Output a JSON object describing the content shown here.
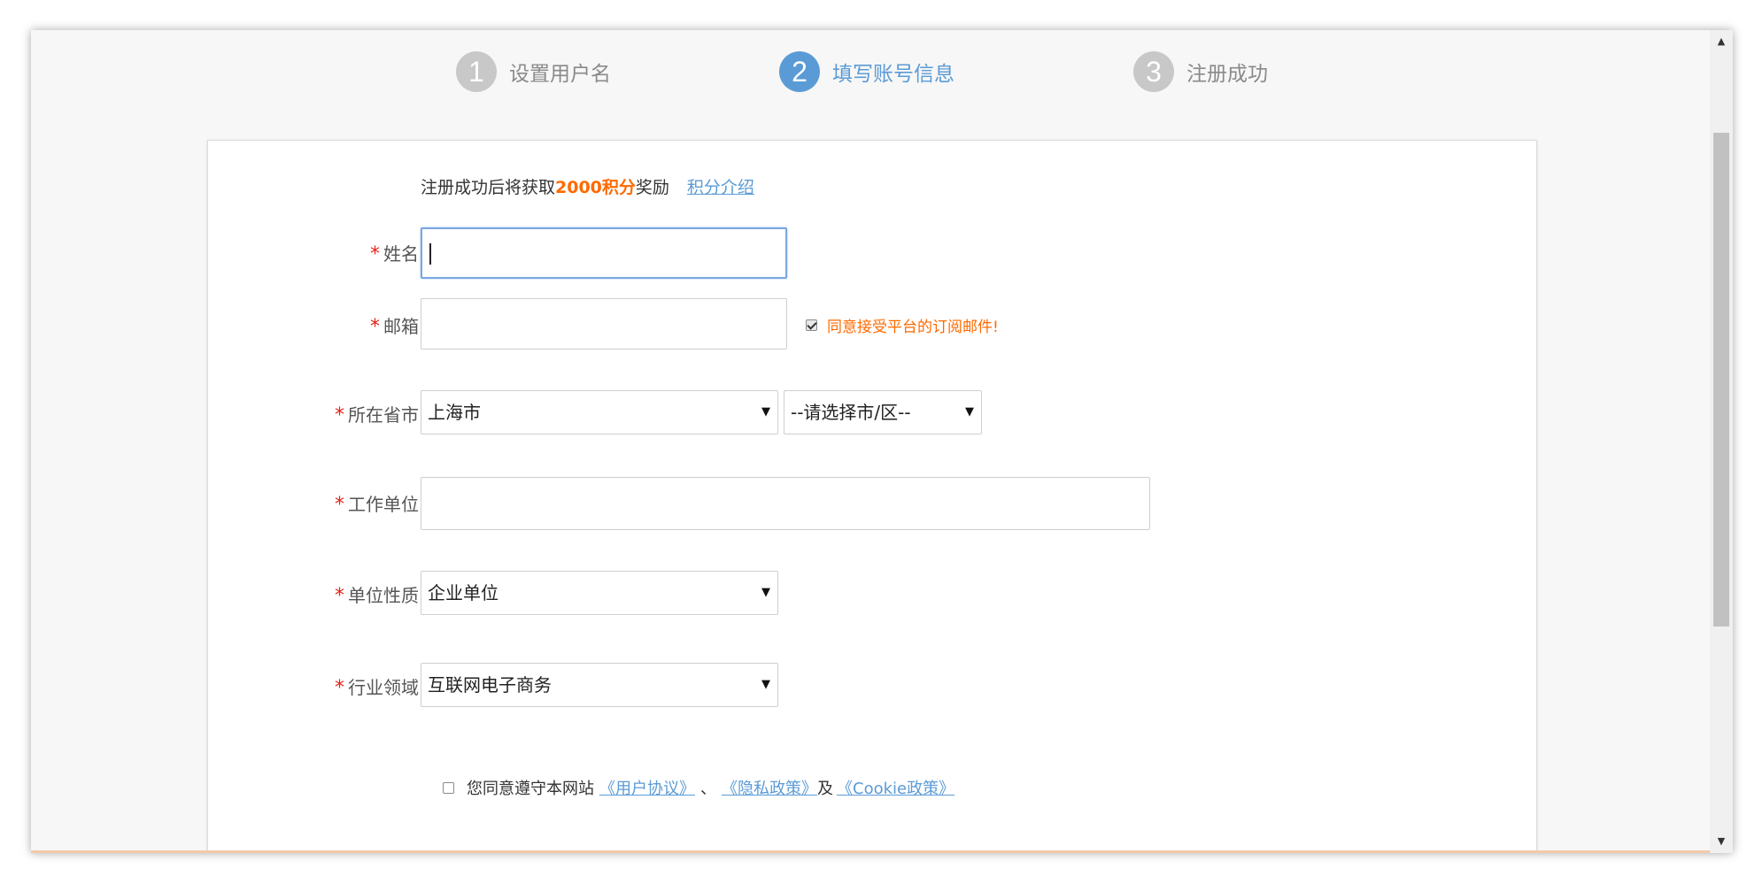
{
  "steps": [
    {
      "num": "1",
      "label": "设置用户名",
      "active": false
    },
    {
      "num": "2",
      "label": "填写账号信息",
      "active": true
    },
    {
      "num": "3",
      "label": "注册成功",
      "active": false
    }
  ],
  "reward": {
    "prefix": "注册成功后将获取",
    "points": "2000积分",
    "suffix": "奖励",
    "link": "积分介绍"
  },
  "form": {
    "required_mark": "*",
    "name_label": "姓名",
    "name_value": "",
    "email_label": "邮箱",
    "email_value": "",
    "subscribe_label": "同意接受平台的订阅邮件!",
    "subscribe_checked": true,
    "city_label": "所在省市",
    "province_selected": "上海市",
    "district_selected": "--请选择市/区--",
    "company_label": "工作单位",
    "company_value": "",
    "nature_label": "单位性质",
    "nature_selected": "企业单位",
    "industry_label": "行业领域",
    "industry_selected": "互联网电子商务",
    "agree_prefix": "您同意遵守本网站",
    "agree_terms": "《用户协议》",
    "agree_sep": "、",
    "agree_privacy": "《隐私政策》",
    "agree_and": "及",
    "agree_cookie": "《Cookie政策》",
    "agree_checked": false
  },
  "icons": {
    "dropdown": "caret-down-icon",
    "scroll_up": "caret-up-icon",
    "scroll_down": "caret-down-icon"
  },
  "colors": {
    "accent_blue": "#5b9bd5",
    "points_orange": "#ff6a00",
    "required_red": "#e2231a",
    "step_inactive": "#c8c8c8"
  }
}
